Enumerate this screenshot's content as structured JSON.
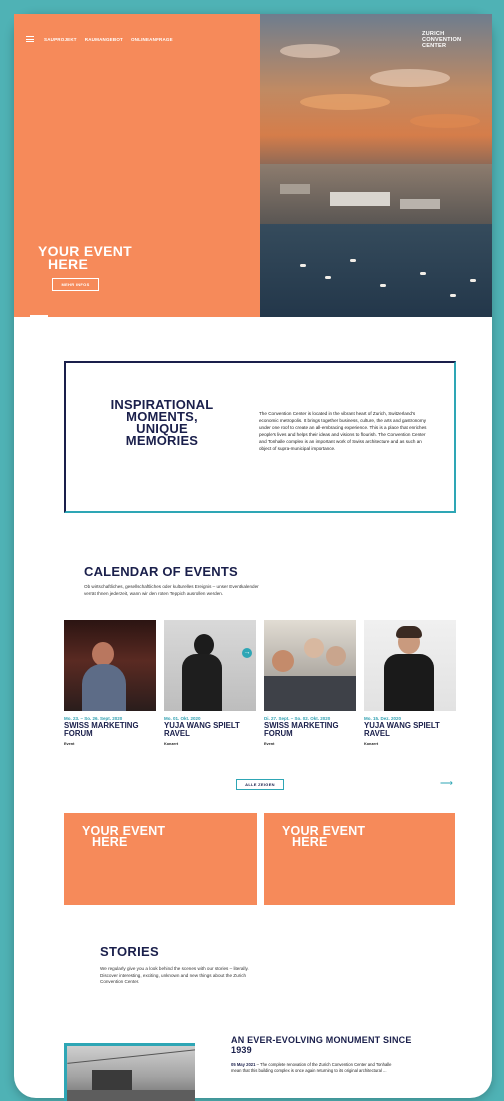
{
  "nav": {
    "items": [
      "SAUPROJEKT",
      "RAUMANGEBOT",
      "ONLINEANFRAGE"
    ]
  },
  "logo": {
    "lines": [
      "ZURICH",
      "CONVENTION",
      "CENTER"
    ]
  },
  "hero": {
    "title_line1": "YOUR EVENT",
    "title_line2": "HERE",
    "button_label": "MEHR INFOS"
  },
  "intro": {
    "title_lines": [
      "INSPIRATIONAL",
      "MOMENTS,",
      "UNIQUE",
      "MEMORIES"
    ],
    "text": "The Convention Center is located in the vibrant heart of Zurich, Switzerland's economic metropolis. It brings together business, culture, the arts and gastronomy under one roof to create an all-embracing experience. This is a place that enriches people's lives and helps their ideas and visions to flourish. The Convention Center and Tonhalle complex is an important work of Swiss architecture and as such an object of supra-municipal importance."
  },
  "calendar": {
    "title": "CALENDAR OF EVENTS",
    "description": "Ob wirtschaftliches, gesellschaftliches oder kulturelles Ereignis – unser Eventkalender verrät Ihnen jederzeit, wann wir den roten Teppich ausrollen werden.",
    "events": [
      {
        "date": "Mo. 23. – So. 26. Sept. 2020",
        "name": "SWISS MARKETING FORUM",
        "category": "Event"
      },
      {
        "date": "Mo. 01. Okt. 2020",
        "name": "YUJA WANG SPIELT RAVEL",
        "category": "Konzert"
      },
      {
        "date": "Di. 27. Sept. – So. 02. Okt. 2020",
        "name": "SWISS MARKETING FORUM",
        "category": "Event"
      },
      {
        "date": "Mo. 15. Dez. 2020",
        "name": "YUJA WANG SPIELT RAVEL",
        "category": "Konzert"
      }
    ],
    "all_button": "ALLE ZEIGEN",
    "next_arrow": "⟶",
    "card_arrow": "→"
  },
  "promos": [
    {
      "line1": "YOUR EVENT",
      "line2": "HERE"
    },
    {
      "line1": "YOUR EVENT",
      "line2": "HERE"
    }
  ],
  "stories": {
    "title": "STORIES",
    "description": "We regularly give you a look behind the scenes with our stories – literally. Discover interesting, exciting, unknown and new things about the Zurich Convention Center.",
    "feature": {
      "title": "AN EVER-EVOLVING MONUMENT SINCE 1939",
      "date": "05 May 2021",
      "excerpt": " – The complete renovation of the Zurich Convention Center and Tonhalle mean that this building complex is once again returning to its original architectural ..."
    }
  },
  "colors": {
    "orange": "#f68a5a",
    "navy": "#1a1f4b",
    "teal": "#2ea6b5",
    "background": "#4fb2b5"
  }
}
